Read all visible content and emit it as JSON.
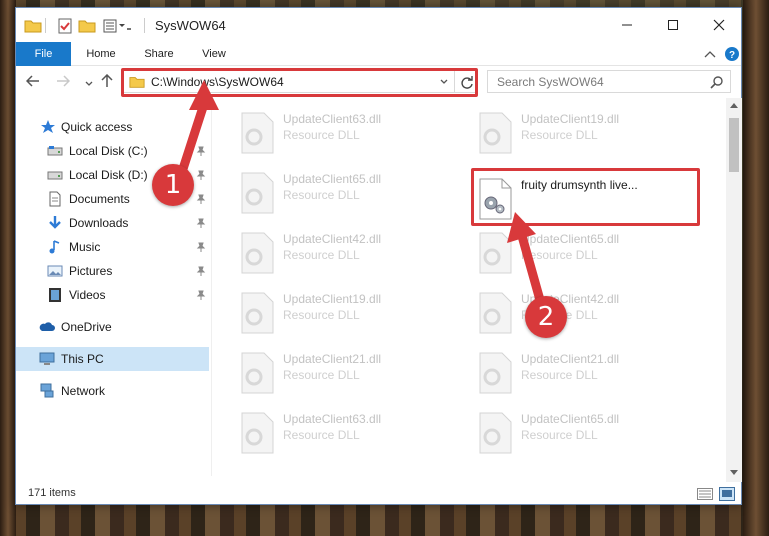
{
  "window": {
    "title": "SysWOW64"
  },
  "ribbon": {
    "tabs": [
      "File",
      "Home",
      "Share",
      "View"
    ]
  },
  "address": {
    "path": "C:\\Windows\\SysWOW64"
  },
  "search": {
    "placeholder": "Search SysWOW64"
  },
  "nav": {
    "items": [
      {
        "label": "Quick access",
        "icon": "star-icon",
        "pinned": false
      },
      {
        "label": "Local Disk (C:)",
        "icon": "drive-icon",
        "pinned": true
      },
      {
        "label": "Local Disk (D:)",
        "icon": "drive-icon",
        "pinned": true
      },
      {
        "label": "Documents",
        "icon": "document-icon",
        "pinned": true
      },
      {
        "label": "Downloads",
        "icon": "download-icon",
        "pinned": true
      },
      {
        "label": "Music",
        "icon": "music-icon",
        "pinned": true
      },
      {
        "label": "Pictures",
        "icon": "picture-icon",
        "pinned": true
      },
      {
        "label": "Videos",
        "icon": "video-icon",
        "pinned": true
      },
      {
        "label": "OneDrive",
        "icon": "cloud-icon",
        "pinned": false
      },
      {
        "label": "This PC",
        "icon": "computer-icon",
        "pinned": false,
        "selected": true
      },
      {
        "label": "Network",
        "icon": "network-icon",
        "pinned": false
      }
    ]
  },
  "files": {
    "left": [
      {
        "name": "UpdateClient63.dll",
        "type": "Resource DLL"
      },
      {
        "name": "UpdateClient65.dll",
        "type": "Resource DLL"
      },
      {
        "name": "UpdateClient42.dll",
        "type": "Resource DLL"
      },
      {
        "name": "UpdateClient19.dll",
        "type": "Resource DLL"
      },
      {
        "name": "UpdateClient21.dll",
        "type": "Resource DLL"
      },
      {
        "name": "UpdateClient63.dll",
        "type": "Resource DLL"
      }
    ],
    "right": [
      {
        "name": "UpdateClient19.dll",
        "type": "Resource DLL"
      },
      {
        "name": "fruity drumsynth live...",
        "type": "",
        "highlighted": true
      },
      {
        "name": "UpdateClient65.dll",
        "type": "Resource DLL"
      },
      {
        "name": "UpdateClient42.dll",
        "type": "Resource DLL"
      },
      {
        "name": "UpdateClient21.dll",
        "type": "Resource DLL"
      },
      {
        "name": "UpdateClient65.dll",
        "type": "Resource DLL"
      }
    ]
  },
  "status": {
    "count": "171 items"
  },
  "annotations": {
    "step1": "1",
    "step2": "2",
    "color": "#d8393b"
  }
}
